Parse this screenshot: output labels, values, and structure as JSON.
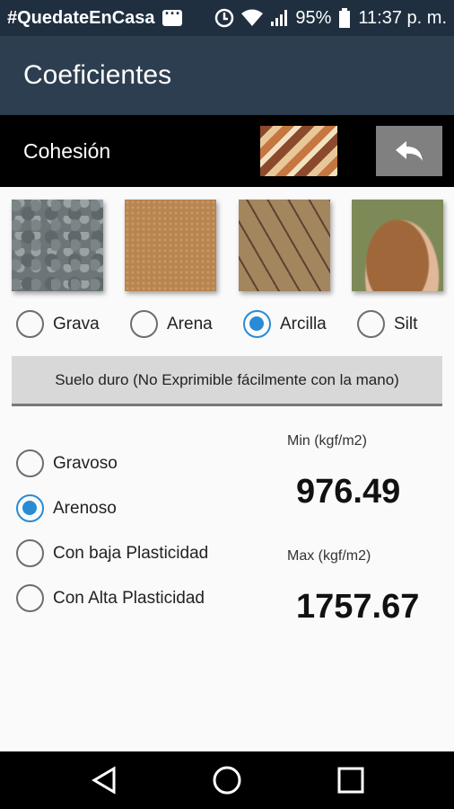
{
  "status_bar": {
    "hashtag": "#QuedateEnCasa",
    "battery": "95%",
    "time": "11:37 p. m."
  },
  "app_bar": {
    "title": "Coeficientes"
  },
  "section": {
    "title": "Cohesión"
  },
  "soil_types": [
    {
      "label": "Grava",
      "checked": false
    },
    {
      "label": "Arena",
      "checked": false
    },
    {
      "label": "Arcilla",
      "checked": true
    },
    {
      "label": "Silt",
      "checked": false
    }
  ],
  "description_button": "Suelo duro (No Exprimible fácilmente con la mano)",
  "sub_types": [
    {
      "label": "Gravoso",
      "checked": false
    },
    {
      "label": "Arenoso",
      "checked": true
    },
    {
      "label": "Con baja Plasticidad",
      "checked": false
    },
    {
      "label": "Con Alta Plasticidad",
      "checked": false
    }
  ],
  "results": {
    "min_label": "Min (kgf/m2)",
    "min_value": "976.49",
    "max_label": "Max (kgf/m2)",
    "max_value": "1757.67"
  },
  "colors": {
    "accent": "#2a8bd5",
    "app_bar": "#2d3e50",
    "status_bar": "#1f2f3f"
  },
  "icons": [
    "message-icon",
    "sync-icon",
    "wifi-icon",
    "signal-icon",
    "battery-icon",
    "back-arrow-icon",
    "nav-back-icon",
    "nav-home-icon",
    "nav-recents-icon"
  ]
}
